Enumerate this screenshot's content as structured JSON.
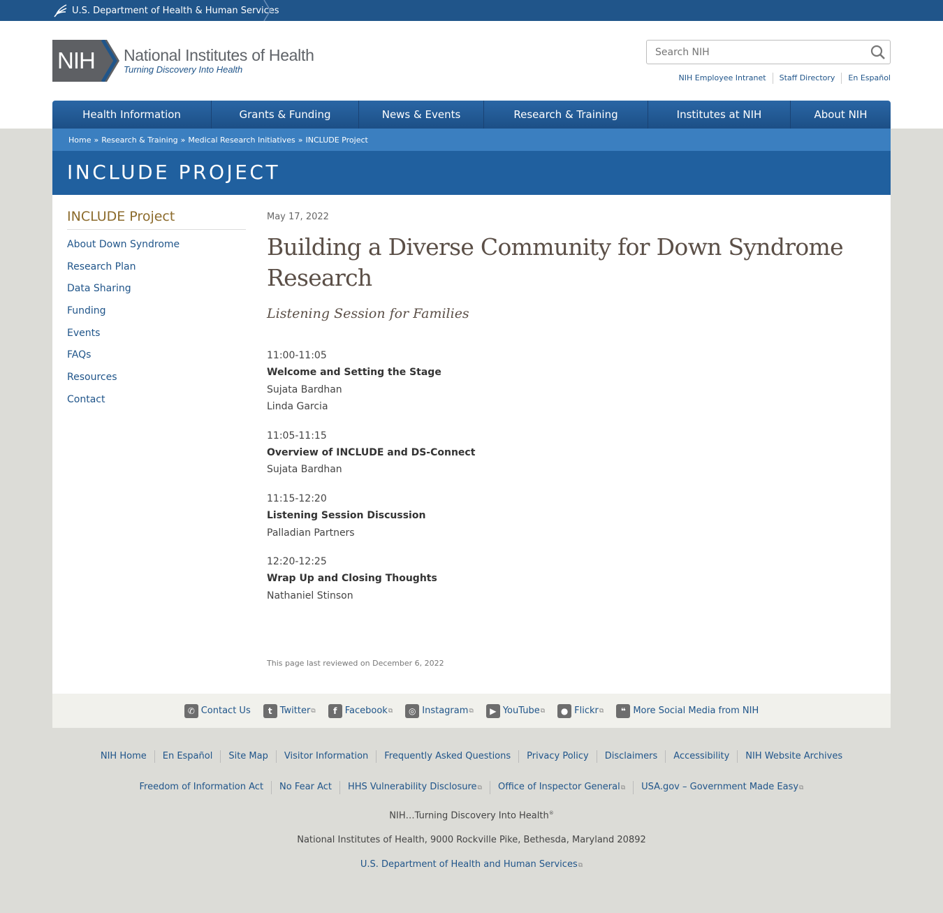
{
  "hhs": {
    "label": "U.S. Department of Health & Human Services"
  },
  "logo": {
    "badge": "NIH",
    "title": "National Institutes of Health",
    "tagline": "Turning Discovery Into Health"
  },
  "search": {
    "placeholder": "Search NIH"
  },
  "util_links": [
    "NIH Employee Intranet",
    "Staff Directory",
    "En Español"
  ],
  "nav": [
    "Health Information",
    "Grants & Funding",
    "News & Events",
    "Research & Training",
    "Institutes at NIH",
    "About NIH"
  ],
  "breadcrumb": [
    "Home",
    "Research & Training",
    "Medical Research Initiatives",
    "INCLUDE Project"
  ],
  "breadcrumb_sep": "»",
  "banner_title": "INCLUDE PROJECT",
  "sidenav": {
    "title": "INCLUDE Project",
    "items": [
      "About Down Syndrome",
      "Research Plan",
      "Data Sharing",
      "Funding",
      "Events",
      "FAQs",
      "Resources",
      "Contact"
    ]
  },
  "article": {
    "date": "May 17, 2022",
    "headline": "Building a Diverse Community for Down Syndrome Research",
    "subhead": "Listening Session for Families",
    "agenda": [
      {
        "time": "11:00-11:05",
        "title": "Welcome and Setting the Stage",
        "people": [
          "Sujata Bardhan",
          "Linda Garcia"
        ]
      },
      {
        "time": "11:05-11:15",
        "title": "Overview of INCLUDE and DS-Connect",
        "people": [
          "Sujata Bardhan"
        ]
      },
      {
        "time": "11:15-12:20",
        "title": "Listening Session Discussion",
        "people": [
          "Palladian Partners"
        ]
      },
      {
        "time": "12:20-12:25",
        "title": "Wrap Up and Closing Thoughts",
        "people": [
          "Nathaniel Stinson"
        ]
      }
    ],
    "reviewed": "This page last reviewed on December 6, 2022"
  },
  "social": [
    {
      "label": "Contact Us",
      "icon": "phone-icon",
      "glyph": "✆",
      "external": false
    },
    {
      "label": "Twitter",
      "icon": "twitter-icon",
      "glyph": "t",
      "external": true
    },
    {
      "label": "Facebook",
      "icon": "facebook-icon",
      "glyph": "f",
      "external": true
    },
    {
      "label": "Instagram",
      "icon": "instagram-icon",
      "glyph": "◎",
      "external": true
    },
    {
      "label": "YouTube",
      "icon": "youtube-icon",
      "glyph": "▶",
      "external": true
    },
    {
      "label": "Flickr",
      "icon": "flickr-icon",
      "glyph": "●",
      "external": true
    },
    {
      "label": "More Social Media from NIH",
      "icon": "social-media-icon",
      "glyph": "❝",
      "external": false
    }
  ],
  "footer": {
    "row1": [
      "NIH Home",
      "En Español",
      "Site Map",
      "Visitor Information",
      "Frequently Asked Questions",
      "Privacy Policy",
      "Disclaimers",
      "Accessibility",
      "NIH Website Archives"
    ],
    "row2": [
      {
        "label": "Freedom of Information Act",
        "external": false
      },
      {
        "label": "No Fear Act",
        "external": false
      },
      {
        "label": "HHS Vulnerability Disclosure",
        "external": true
      },
      {
        "label": "Office of Inspector General",
        "external": true
      },
      {
        "label": "USA.gov – Government Made Easy",
        "external": true
      }
    ],
    "tagline": "NIH…Turning Discovery Into Health",
    "tagline_mark": "®",
    "address": "National Institutes of Health, 9000 Rockville Pike, Bethesda, Maryland 20892",
    "hhs_link": "U.S. Department of Health and Human Services"
  },
  "colors": {
    "primary": "#20558a",
    "accent_gold": "#8c6b2c",
    "banner": "#20609f"
  }
}
